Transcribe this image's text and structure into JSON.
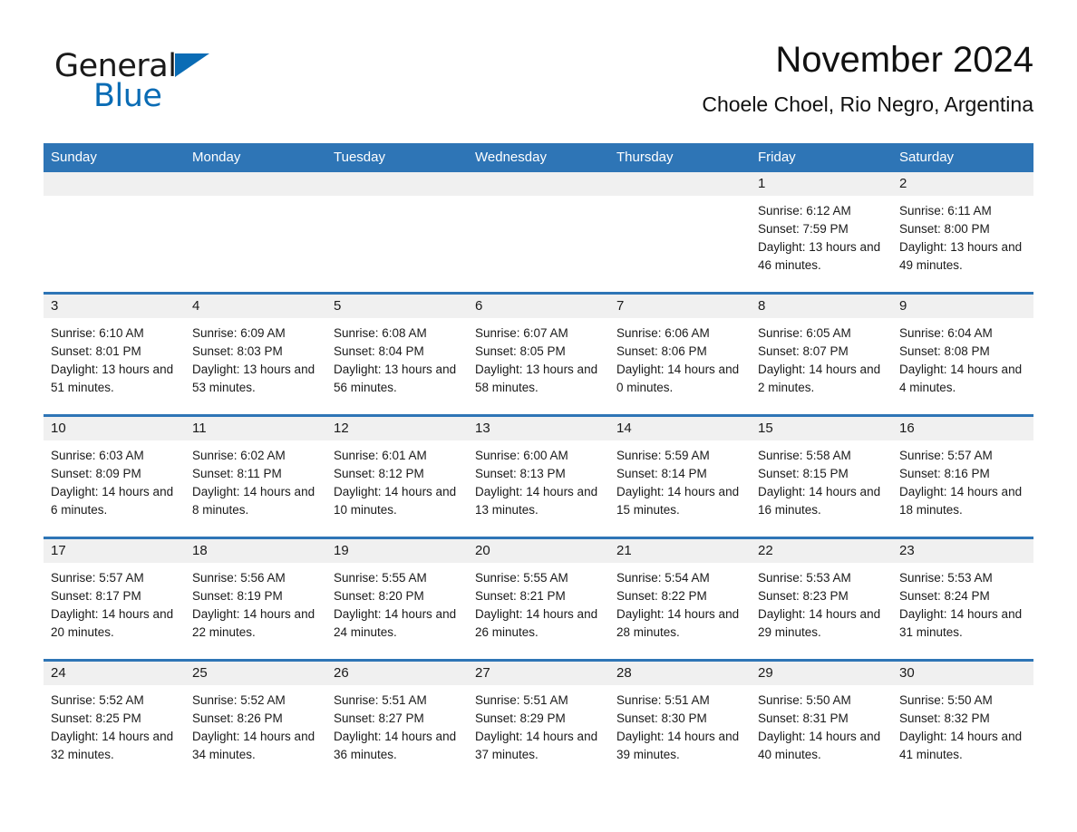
{
  "brand": {
    "name_part1": "General",
    "name_part2": "Blue",
    "triangle_color": "#0a6cb5"
  },
  "header": {
    "title": "November 2024",
    "subtitle": "Choele Choel, Rio Negro, Argentina"
  },
  "theme": {
    "header_blue": "#2e75b6",
    "daynum_band": "#f0f0f0",
    "text": "#1a1a1a"
  },
  "weekday_headers": [
    "Sunday",
    "Monday",
    "Tuesday",
    "Wednesday",
    "Thursday",
    "Friday",
    "Saturday"
  ],
  "weeks": [
    {
      "days": [
        {
          "date": "",
          "sunrise": "",
          "sunset": "",
          "daylight": ""
        },
        {
          "date": "",
          "sunrise": "",
          "sunset": "",
          "daylight": ""
        },
        {
          "date": "",
          "sunrise": "",
          "sunset": "",
          "daylight": ""
        },
        {
          "date": "",
          "sunrise": "",
          "sunset": "",
          "daylight": ""
        },
        {
          "date": "",
          "sunrise": "",
          "sunset": "",
          "daylight": ""
        },
        {
          "date": "1",
          "sunrise": "Sunrise: 6:12 AM",
          "sunset": "Sunset: 7:59 PM",
          "daylight": "Daylight: 13 hours and 46 minutes."
        },
        {
          "date": "2",
          "sunrise": "Sunrise: 6:11 AM",
          "sunset": "Sunset: 8:00 PM",
          "daylight": "Daylight: 13 hours and 49 minutes."
        }
      ]
    },
    {
      "days": [
        {
          "date": "3",
          "sunrise": "Sunrise: 6:10 AM",
          "sunset": "Sunset: 8:01 PM",
          "daylight": "Daylight: 13 hours and 51 minutes."
        },
        {
          "date": "4",
          "sunrise": "Sunrise: 6:09 AM",
          "sunset": "Sunset: 8:03 PM",
          "daylight": "Daylight: 13 hours and 53 minutes."
        },
        {
          "date": "5",
          "sunrise": "Sunrise: 6:08 AM",
          "sunset": "Sunset: 8:04 PM",
          "daylight": "Daylight: 13 hours and 56 minutes."
        },
        {
          "date": "6",
          "sunrise": "Sunrise: 6:07 AM",
          "sunset": "Sunset: 8:05 PM",
          "daylight": "Daylight: 13 hours and 58 minutes."
        },
        {
          "date": "7",
          "sunrise": "Sunrise: 6:06 AM",
          "sunset": "Sunset: 8:06 PM",
          "daylight": "Daylight: 14 hours and 0 minutes."
        },
        {
          "date": "8",
          "sunrise": "Sunrise: 6:05 AM",
          "sunset": "Sunset: 8:07 PM",
          "daylight": "Daylight: 14 hours and 2 minutes."
        },
        {
          "date": "9",
          "sunrise": "Sunrise: 6:04 AM",
          "sunset": "Sunset: 8:08 PM",
          "daylight": "Daylight: 14 hours and 4 minutes."
        }
      ]
    },
    {
      "days": [
        {
          "date": "10",
          "sunrise": "Sunrise: 6:03 AM",
          "sunset": "Sunset: 8:09 PM",
          "daylight": "Daylight: 14 hours and 6 minutes."
        },
        {
          "date": "11",
          "sunrise": "Sunrise: 6:02 AM",
          "sunset": "Sunset: 8:11 PM",
          "daylight": "Daylight: 14 hours and 8 minutes."
        },
        {
          "date": "12",
          "sunrise": "Sunrise: 6:01 AM",
          "sunset": "Sunset: 8:12 PM",
          "daylight": "Daylight: 14 hours and 10 minutes."
        },
        {
          "date": "13",
          "sunrise": "Sunrise: 6:00 AM",
          "sunset": "Sunset: 8:13 PM",
          "daylight": "Daylight: 14 hours and 13 minutes."
        },
        {
          "date": "14",
          "sunrise": "Sunrise: 5:59 AM",
          "sunset": "Sunset: 8:14 PM",
          "daylight": "Daylight: 14 hours and 15 minutes."
        },
        {
          "date": "15",
          "sunrise": "Sunrise: 5:58 AM",
          "sunset": "Sunset: 8:15 PM",
          "daylight": "Daylight: 14 hours and 16 minutes."
        },
        {
          "date": "16",
          "sunrise": "Sunrise: 5:57 AM",
          "sunset": "Sunset: 8:16 PM",
          "daylight": "Daylight: 14 hours and 18 minutes."
        }
      ]
    },
    {
      "days": [
        {
          "date": "17",
          "sunrise": "Sunrise: 5:57 AM",
          "sunset": "Sunset: 8:17 PM",
          "daylight": "Daylight: 14 hours and 20 minutes."
        },
        {
          "date": "18",
          "sunrise": "Sunrise: 5:56 AM",
          "sunset": "Sunset: 8:19 PM",
          "daylight": "Daylight: 14 hours and 22 minutes."
        },
        {
          "date": "19",
          "sunrise": "Sunrise: 5:55 AM",
          "sunset": "Sunset: 8:20 PM",
          "daylight": "Daylight: 14 hours and 24 minutes."
        },
        {
          "date": "20",
          "sunrise": "Sunrise: 5:55 AM",
          "sunset": "Sunset: 8:21 PM",
          "daylight": "Daylight: 14 hours and 26 minutes."
        },
        {
          "date": "21",
          "sunrise": "Sunrise: 5:54 AM",
          "sunset": "Sunset: 8:22 PM",
          "daylight": "Daylight: 14 hours and 28 minutes."
        },
        {
          "date": "22",
          "sunrise": "Sunrise: 5:53 AM",
          "sunset": "Sunset: 8:23 PM",
          "daylight": "Daylight: 14 hours and 29 minutes."
        },
        {
          "date": "23",
          "sunrise": "Sunrise: 5:53 AM",
          "sunset": "Sunset: 8:24 PM",
          "daylight": "Daylight: 14 hours and 31 minutes."
        }
      ]
    },
    {
      "days": [
        {
          "date": "24",
          "sunrise": "Sunrise: 5:52 AM",
          "sunset": "Sunset: 8:25 PM",
          "daylight": "Daylight: 14 hours and 32 minutes."
        },
        {
          "date": "25",
          "sunrise": "Sunrise: 5:52 AM",
          "sunset": "Sunset: 8:26 PM",
          "daylight": "Daylight: 14 hours and 34 minutes."
        },
        {
          "date": "26",
          "sunrise": "Sunrise: 5:51 AM",
          "sunset": "Sunset: 8:27 PM",
          "daylight": "Daylight: 14 hours and 36 minutes."
        },
        {
          "date": "27",
          "sunrise": "Sunrise: 5:51 AM",
          "sunset": "Sunset: 8:29 PM",
          "daylight": "Daylight: 14 hours and 37 minutes."
        },
        {
          "date": "28",
          "sunrise": "Sunrise: 5:51 AM",
          "sunset": "Sunset: 8:30 PM",
          "daylight": "Daylight: 14 hours and 39 minutes."
        },
        {
          "date": "29",
          "sunrise": "Sunrise: 5:50 AM",
          "sunset": "Sunset: 8:31 PM",
          "daylight": "Daylight: 14 hours and 40 minutes."
        },
        {
          "date": "30",
          "sunrise": "Sunrise: 5:50 AM",
          "sunset": "Sunset: 8:32 PM",
          "daylight": "Daylight: 14 hours and 41 minutes."
        }
      ]
    }
  ]
}
